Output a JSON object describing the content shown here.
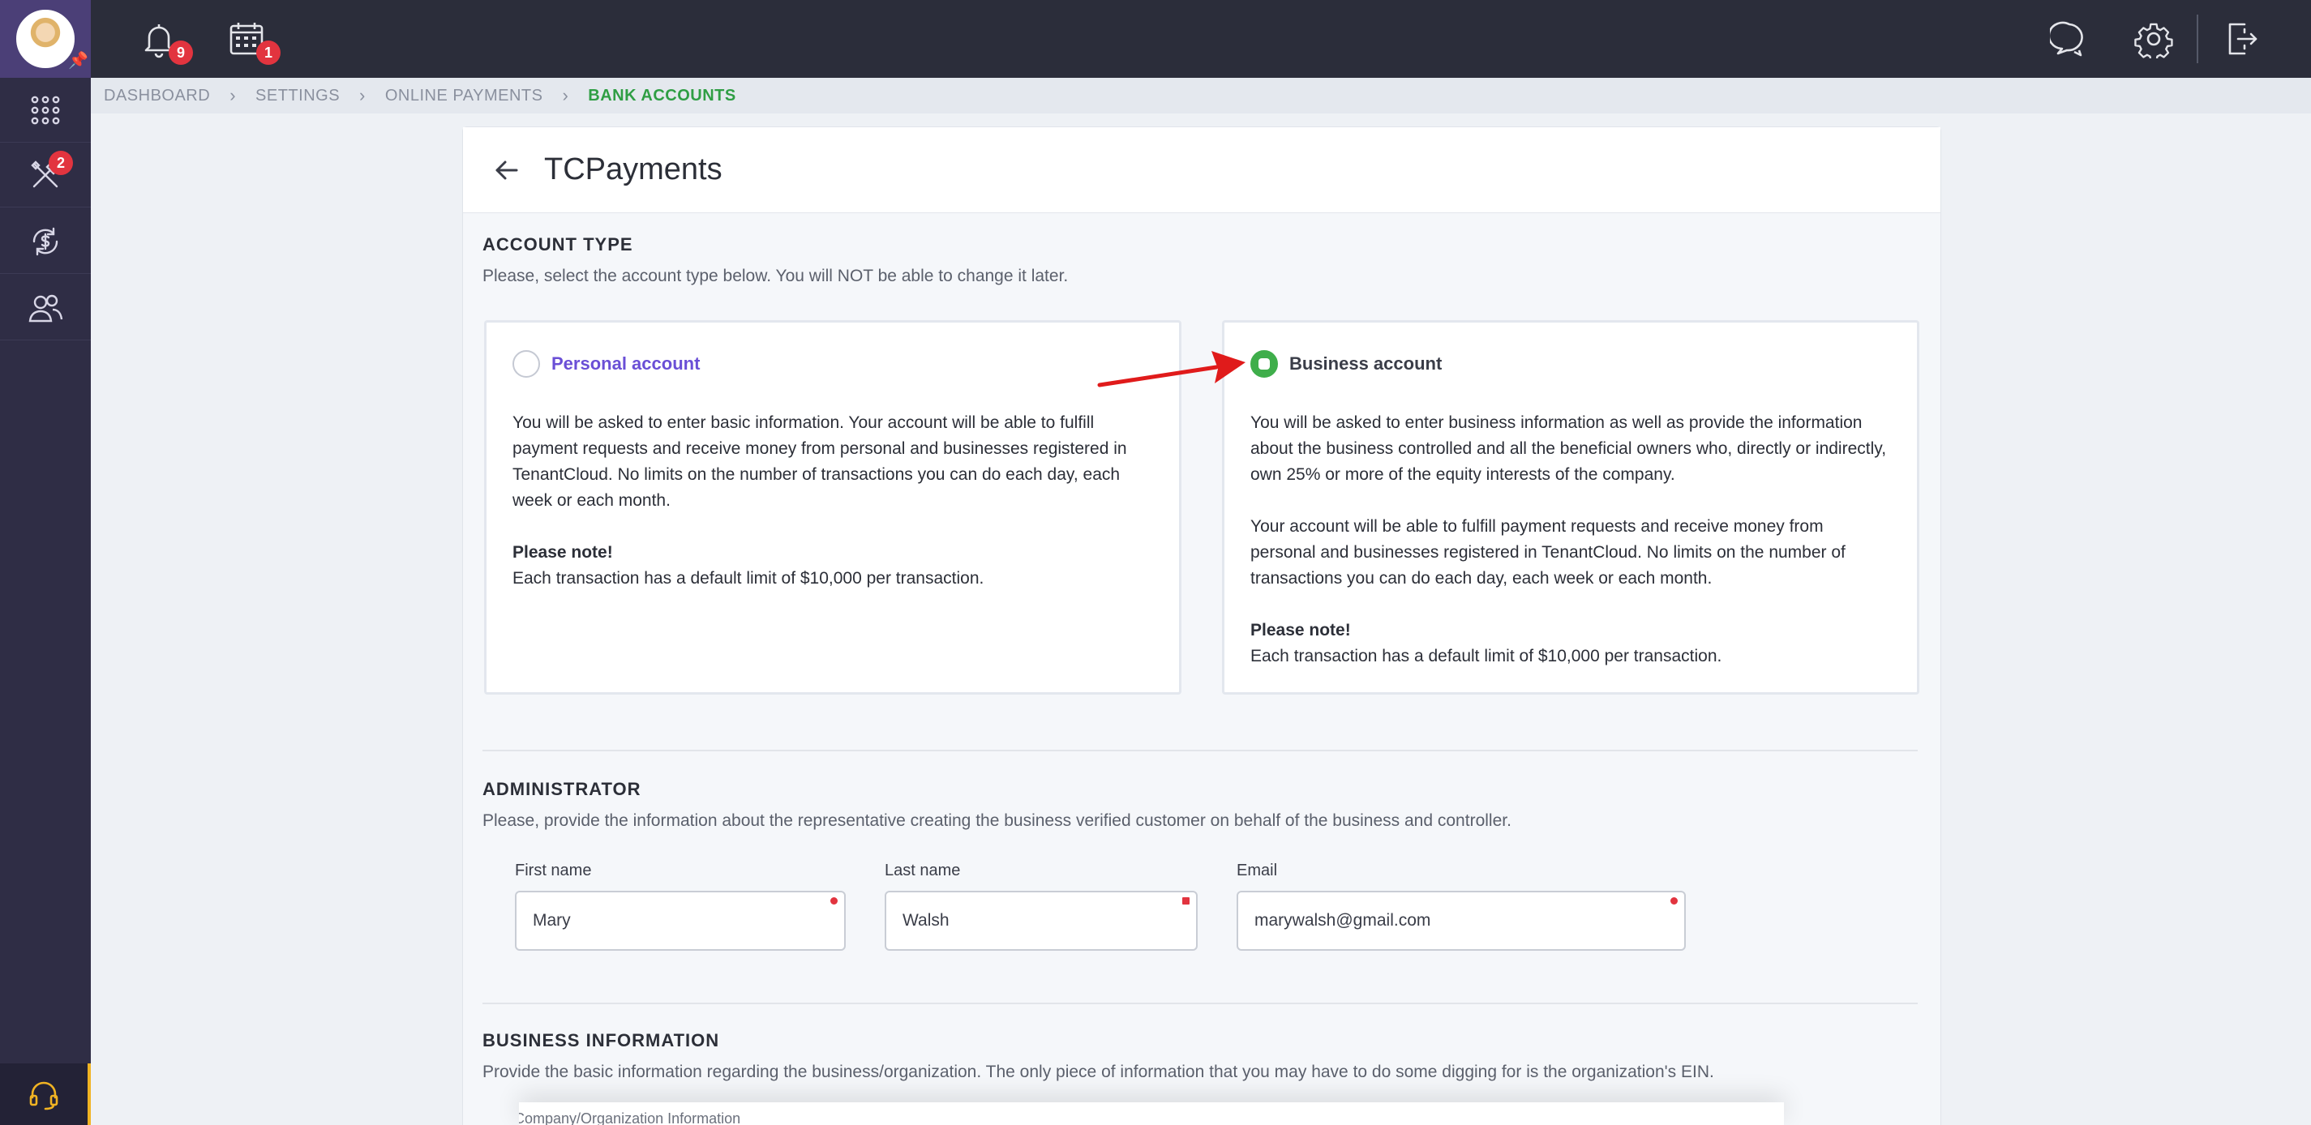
{
  "sidebar": {
    "tools_badge": "2"
  },
  "topbar": {
    "notifications_badge": "9",
    "calendar_badge": "1"
  },
  "breadcrumb": [
    "DASHBOARD",
    "SETTINGS",
    "ONLINE PAYMENTS",
    "BANK ACCOUNTS"
  ],
  "page": {
    "title": "TCPayments"
  },
  "account_type": {
    "title": "ACCOUNT TYPE",
    "description": "Please, select the account type below. You will NOT be able to change it later.",
    "personal": {
      "label": "Personal account",
      "text": "You will be asked to enter basic information. Your account will be able to fulfill payment requests and receive money from personal and businesses registered in TenantCloud. No limits on the number of transactions you can do each day, each week or each month.",
      "note_title": "Please note!",
      "note": "Each transaction has a default limit of $10,000 per transaction."
    },
    "business": {
      "label": "Business account",
      "selected": true,
      "text1": "You will be asked to enter business information as well as provide the information about the business controlled and all the beneficial owners who, directly or indirectly, own 25% or more of the equity interests of the company.",
      "text2": "Your account will be able to fulfill payment requests and receive money from personal and businesses registered in TenantCloud. No limits on the number of transactions you can do each day, each week or each month.",
      "note_title": "Please note!",
      "note": "Each transaction has a default limit of $10,000 per transaction."
    }
  },
  "administrator": {
    "title": "ADMINISTRATOR",
    "description": "Please, provide the information about the representative creating the business verified customer on behalf of the business and controller.",
    "first_name_label": "First name",
    "first_name_value": "Mary",
    "last_name_label": "Last name",
    "last_name_value": "Walsh",
    "email_label": "Email",
    "email_value": "marywalsh@gmail.com"
  },
  "business_info": {
    "title": "BUSINESS INFORMATION",
    "description": "Provide the basic information regarding the business/organization. The only piece of information that you may have to do some digging for is the organization's EIN.",
    "sub_label": "Company/Organization Information"
  },
  "colors": {
    "accent_green": "#3fae4b",
    "personal_purple": "#6a4fd6",
    "badge_red": "#e2343f",
    "arrow_red": "#e01b1b"
  }
}
